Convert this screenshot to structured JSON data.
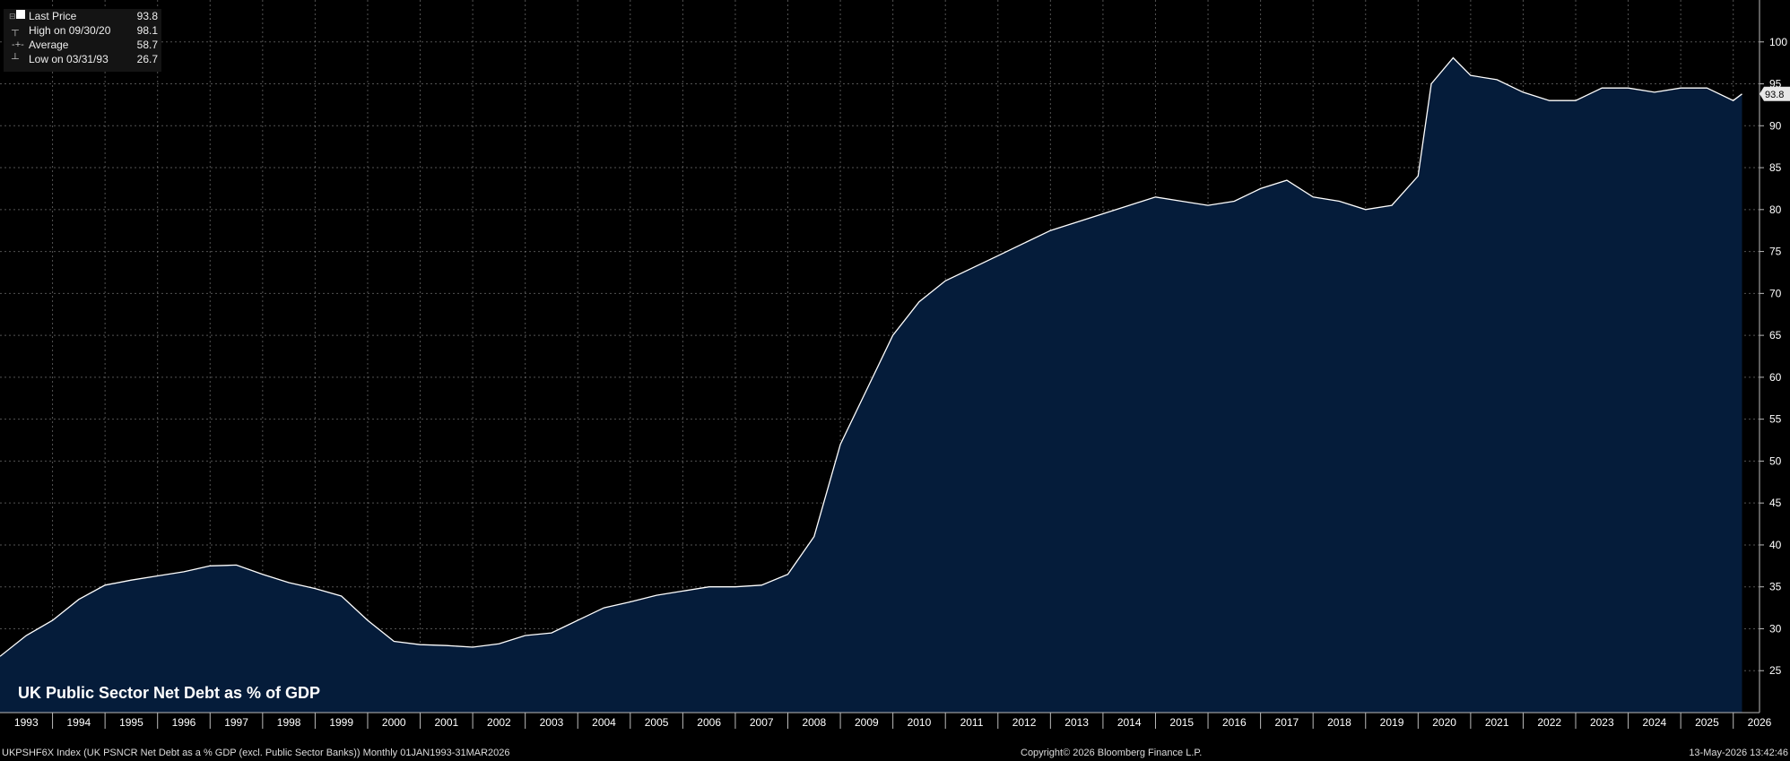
{
  "legend": {
    "items": [
      {
        "label": "Last Price",
        "value": "93.8",
        "mark": "square"
      },
      {
        "label": "High on 09/30/20",
        "value": "98.1",
        "mark": "high"
      },
      {
        "label": "Average",
        "value": "58.7",
        "mark": "avg"
      },
      {
        "label": "Low on 03/31/93",
        "value": "26.7",
        "mark": "low"
      }
    ]
  },
  "chart_title": "UK Public Sector Net Debt as % of GDP",
  "last_price_tag": "93.8",
  "footer": {
    "left": "UKPSHF6X Index (UK PSNCR Net Debt as a % GDP (excl. Public Sector Banks)) Monthly 01JAN1993-31MAR2026",
    "center": "Copyright© 2026 Bloomberg Finance L.P.",
    "right": "13-May-2026 13:42:46"
  },
  "colors": {
    "background": "#000000",
    "area_fill": "#051c3a",
    "line": "#ffffff",
    "grid": "#8a8a8a"
  },
  "chart_data": {
    "type": "area",
    "series": [
      {
        "x": [
          "1993-01",
          "1993-07",
          "1994-01",
          "1994-07",
          "1995-01",
          "1995-07",
          "1996-01",
          "1996-07",
          "1997-01",
          "1997-07",
          "1998-01",
          "1998-07",
          "1999-01",
          "1999-07",
          "2000-01",
          "2000-07",
          "2001-01",
          "2001-07",
          "2002-01",
          "2002-07",
          "2003-01",
          "2003-07",
          "2004-01",
          "2004-07",
          "2005-01",
          "2005-07",
          "2006-01",
          "2006-07",
          "2007-01",
          "2007-07",
          "2008-01",
          "2008-07",
          "2009-01",
          "2009-07",
          "2010-01",
          "2010-07",
          "2011-01",
          "2011-07",
          "2012-01",
          "2012-07",
          "2013-01",
          "2013-07",
          "2014-01",
          "2014-07",
          "2015-01",
          "2015-07",
          "2016-01",
          "2016-07",
          "2017-01",
          "2017-07",
          "2018-01",
          "2018-07",
          "2019-01",
          "2019-07",
          "2020-01",
          "2020-04",
          "2020-09",
          "2021-01",
          "2021-07",
          "2022-01",
          "2022-07",
          "2023-01",
          "2023-07",
          "2024-01",
          "2024-07",
          "2025-01",
          "2025-07",
          "2026-01",
          "2026-03"
        ],
        "y": [
          26.7,
          29.2,
          31.0,
          33.5,
          35.2,
          35.8,
          36.3,
          36.8,
          37.5,
          37.6,
          36.5,
          35.5,
          34.8,
          33.9,
          31.0,
          28.5,
          28.1,
          28.0,
          27.8,
          28.2,
          29.2,
          29.5,
          31.0,
          32.5,
          33.2,
          34.0,
          34.5,
          35.0,
          35.0,
          35.2,
          36.5,
          41.0,
          52.0,
          58.5,
          65.0,
          69.0,
          71.5,
          73.0,
          74.5,
          76.0,
          77.5,
          78.5,
          79.5,
          80.5,
          81.5,
          81.0,
          80.5,
          81.0,
          82.5,
          83.5,
          81.5,
          81.0,
          80.0,
          80.5,
          84.0,
          95.0,
          98.1,
          96.0,
          95.5,
          94.0,
          93.0,
          93.0,
          94.5,
          94.5,
          94.0,
          94.5,
          94.5,
          93.0,
          93.8
        ]
      }
    ],
    "x_ticks": [
      "1993",
      "1994",
      "1995",
      "1996",
      "1997",
      "1998",
      "1999",
      "2000",
      "2001",
      "2002",
      "2003",
      "2004",
      "2005",
      "2006",
      "2007",
      "2008",
      "2009",
      "2010",
      "2011",
      "2012",
      "2013",
      "2014",
      "2015",
      "2016",
      "2017",
      "2018",
      "2019",
      "2020",
      "2021",
      "2022",
      "2023",
      "2024",
      "2025",
      "2026"
    ],
    "y_ticks": [
      25,
      30,
      35,
      40,
      45,
      50,
      55,
      60,
      65,
      70,
      75,
      80,
      85,
      90,
      95,
      100
    ],
    "ylim": [
      20,
      105
    ],
    "y_axis_side": "right",
    "grid": true
  }
}
